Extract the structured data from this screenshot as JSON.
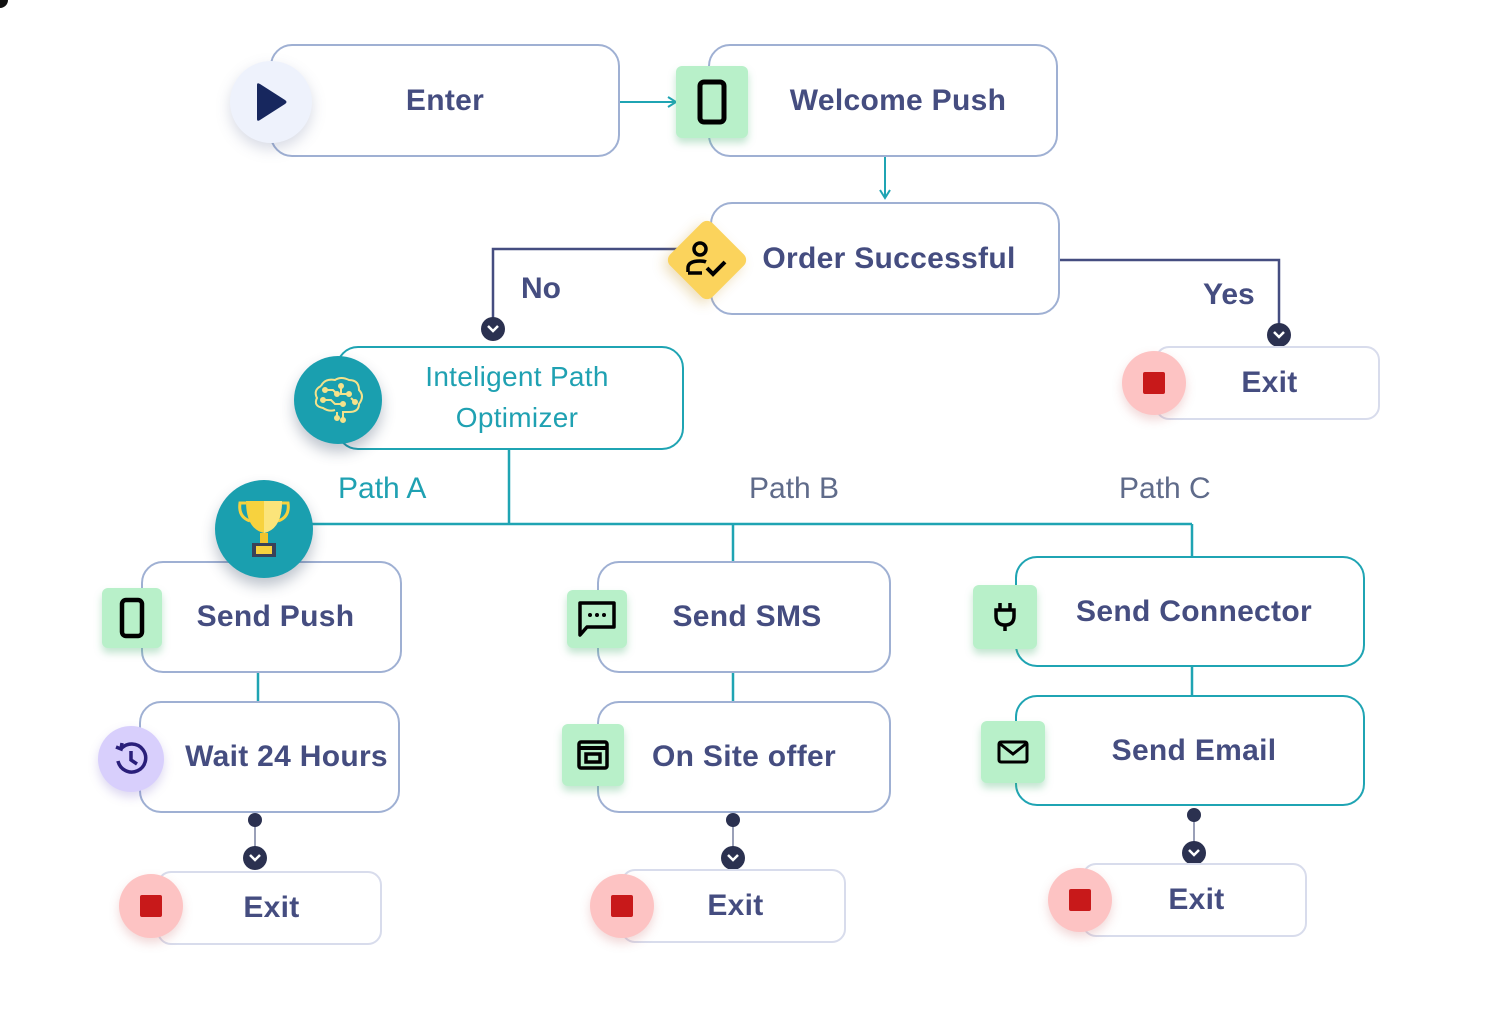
{
  "diagram": {
    "nodes": {
      "enter": {
        "label": "Enter",
        "icon": "play-icon"
      },
      "welcome_push": {
        "label": "Welcome Push",
        "icon": "mobile-phone-icon"
      },
      "order_successful": {
        "label": "Order Successful",
        "icon": "user-check-icon"
      },
      "exit_yes": {
        "label": "Exit",
        "icon": "stop-icon"
      },
      "optimizer": {
        "label_line1": "Inteligent Path",
        "label_line2": "Optimizer",
        "icon": "brain-circuit-icon"
      },
      "send_push": {
        "label": "Send Push",
        "icon": "mobile-phone-icon"
      },
      "wait": {
        "label": "Wait 24 Hours",
        "icon": "history-clock-icon"
      },
      "exit_a": {
        "label": "Exit",
        "icon": "stop-icon"
      },
      "send_sms": {
        "label": "Send SMS",
        "icon": "chat-bubble-icon"
      },
      "on_site_offer": {
        "label": "On Site offer",
        "icon": "browser-window-icon"
      },
      "exit_b": {
        "label": "Exit",
        "icon": "stop-icon"
      },
      "send_connector": {
        "label": "Send Connector",
        "icon": "plug-icon"
      },
      "send_email": {
        "label": "Send Email",
        "icon": "envelope-icon"
      },
      "exit_c": {
        "label": "Exit",
        "icon": "stop-icon"
      }
    },
    "edge_labels": {
      "no": "No",
      "yes": "Yes",
      "path_a": "Path A",
      "path_b": "Path B",
      "path_c": "Path C"
    },
    "winner_badge": "trophy-icon",
    "edges": [
      {
        "from": "enter",
        "to": "welcome_push"
      },
      {
        "from": "welcome_push",
        "to": "order_successful"
      },
      {
        "from": "order_successful",
        "to": "optimizer",
        "label": "No"
      },
      {
        "from": "order_successful",
        "to": "exit_yes",
        "label": "Yes"
      },
      {
        "from": "optimizer",
        "to": "send_push",
        "label": "Path A"
      },
      {
        "from": "optimizer",
        "to": "send_sms",
        "label": "Path B"
      },
      {
        "from": "optimizer",
        "to": "send_connector",
        "label": "Path C"
      },
      {
        "from": "send_push",
        "to": "wait"
      },
      {
        "from": "wait",
        "to": "exit_a"
      },
      {
        "from": "send_sms",
        "to": "on_site_offer"
      },
      {
        "from": "on_site_offer",
        "to": "exit_b"
      },
      {
        "from": "send_connector",
        "to": "send_email"
      },
      {
        "from": "send_email",
        "to": "exit_c"
      }
    ],
    "colors": {
      "text": "#454d80",
      "teal": "#1fa4b3",
      "node_border": "#9fb0d3",
      "green_badge": "#b8f0c9",
      "exit_red": "#c8191a",
      "decision_yellow": "#fbd35c"
    }
  }
}
